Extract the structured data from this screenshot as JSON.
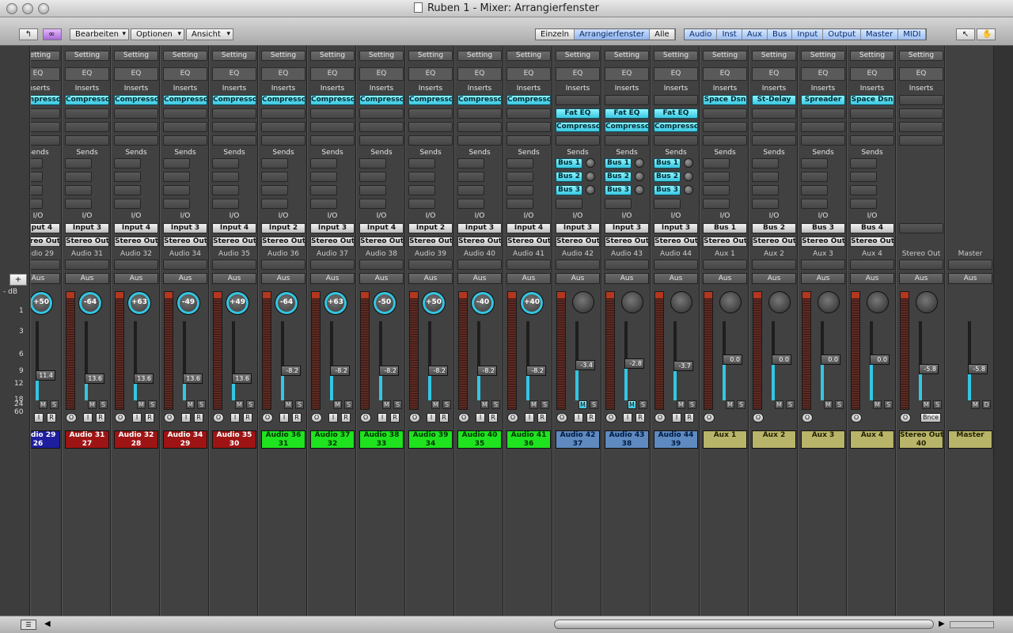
{
  "window": {
    "title": "Ruben 1 - Mixer: Arrangierfenster"
  },
  "toolbar": {
    "edit": "Bearbeiten",
    "options": "Optionen",
    "view": "Ansicht",
    "views": [
      {
        "label": "Einzeln",
        "on": false
      },
      {
        "label": "Arrangierfenster",
        "on": true
      },
      {
        "label": "Alle",
        "on": false
      }
    ],
    "filters": [
      "Audio",
      "Inst",
      "Aux",
      "Bus",
      "Input",
      "Output",
      "Master",
      "MIDI"
    ]
  },
  "labels": {
    "setting": "Setting",
    "eq": "EQ",
    "inserts": "Inserts",
    "sends": "Sends",
    "io": "I/O",
    "aus": "Aus",
    "plus": "+",
    "db": "- dB",
    "scale": [
      "1",
      "3",
      "6",
      "9",
      "12",
      "18",
      "24",
      "60"
    ]
  },
  "strips": [
    {
      "name": "Audio 29",
      "input": "Input 4",
      "output": "Stereo Out",
      "inserts": [
        "Compresso"
      ],
      "sends": [],
      "pan": "+50",
      "vol": "11.4",
      "level": 0.32,
      "color": "#1e1e9e",
      "tc": "#ffffff",
      "cname": [
        "Audio 29",
        "26"
      ],
      "w": 40
    },
    {
      "name": "Audio 31",
      "input": "Input 3",
      "output": "Stereo Out",
      "inserts": [
        "Compresso"
      ],
      "sends": [],
      "pan": "-64",
      "vol": "13.6",
      "level": 0.28,
      "color": "#9e1414",
      "tc": "#ffffff",
      "cname": [
        "Audio 31",
        "27"
      ]
    },
    {
      "name": "Audio 32",
      "input": "Input 4",
      "output": "Stereo Out",
      "inserts": [
        "Compresso"
      ],
      "sends": [],
      "pan": "+63",
      "vol": "13.6",
      "level": 0.28,
      "color": "#9e1414",
      "tc": "#ffffff",
      "cname": [
        "Audio 32",
        "28"
      ]
    },
    {
      "name": "Audio 34",
      "input": "Input 3",
      "output": "Stereo Out",
      "inserts": [
        "Compresso"
      ],
      "sends": [],
      "pan": "-49",
      "vol": "13.6",
      "level": 0.28,
      "color": "#9e1414",
      "tc": "#ffffff",
      "cname": [
        "Audio 34",
        "29"
      ]
    },
    {
      "name": "Audio 35",
      "input": "Input 4",
      "output": "Stereo Out",
      "inserts": [
        "Compresso"
      ],
      "sends": [],
      "pan": "+49",
      "vol": "13.6",
      "level": 0.28,
      "color": "#9e1414",
      "tc": "#ffffff",
      "cname": [
        "Audio 35",
        "30"
      ]
    },
    {
      "name": "Audio 36",
      "input": "Input 2",
      "output": "Stereo Out",
      "inserts": [
        "Compresso"
      ],
      "sends": [],
      "pan": "-64",
      "vol": "-8.2",
      "level": 0.38,
      "color": "#1fe31f",
      "tc": "#003300",
      "cname": [
        "Audio 36",
        "31"
      ]
    },
    {
      "name": "Audio 37",
      "input": "Input 3",
      "output": "Stereo Out",
      "inserts": [
        "Compresso"
      ],
      "sends": [],
      "pan": "+63",
      "vol": "-8.2",
      "level": 0.38,
      "color": "#1fe31f",
      "tc": "#003300",
      "cname": [
        "Audio 37",
        "32"
      ]
    },
    {
      "name": "Audio 38",
      "input": "Input 4",
      "output": "Stereo Out",
      "inserts": [
        "Compresso"
      ],
      "sends": [],
      "pan": "-50",
      "vol": "-8.2",
      "level": 0.38,
      "color": "#1fe31f",
      "tc": "#003300",
      "cname": [
        "Audio 38",
        "33"
      ]
    },
    {
      "name": "Audio 39",
      "input": "Input 2",
      "output": "Stereo Out",
      "inserts": [
        "Compresso"
      ],
      "sends": [],
      "pan": "+50",
      "vol": "-8.2",
      "level": 0.38,
      "color": "#1fe31f",
      "tc": "#003300",
      "cname": [
        "Audio 39",
        "34"
      ]
    },
    {
      "name": "Audio 40",
      "input": "Input 3",
      "output": "Stereo Out",
      "inserts": [
        "Compresso"
      ],
      "sends": [],
      "pan": "-40",
      "vol": "-8.2",
      "level": 0.38,
      "color": "#1fe31f",
      "tc": "#003300",
      "cname": [
        "Audio 40",
        "35"
      ]
    },
    {
      "name": "Audio 41",
      "input": "Input 4",
      "output": "Stereo Out",
      "inserts": [
        "Compresso"
      ],
      "sends": [],
      "pan": "+40",
      "vol": "-8.2",
      "level": 0.38,
      "color": "#1fe31f",
      "tc": "#003300",
      "cname": [
        "Audio 41",
        "36"
      ]
    },
    {
      "name": "Audio 42",
      "input": "Input 3",
      "output": "Stereo Out",
      "inserts": [
        "",
        "Fat EQ",
        "Compresso"
      ],
      "sends": [
        "Bus 1",
        "Bus 2",
        "Bus 3"
      ],
      "pan": "",
      "vol": "-3.4",
      "level": 0.45,
      "mute": true,
      "color": "#5e8ac0",
      "tc": "#001a40",
      "cname": [
        "Audio 42",
        "37"
      ]
    },
    {
      "name": "Audio 43",
      "input": "Input 3",
      "output": "Stereo Out",
      "inserts": [
        "",
        "Fat EQ",
        "Compresso"
      ],
      "sends": [
        "Bus 1",
        "Bus 2",
        "Bus 3"
      ],
      "pan": "",
      "vol": "-2.8",
      "level": 0.47,
      "mute": true,
      "color": "#5e8ac0",
      "tc": "#001a40",
      "cname": [
        "Audio 43",
        "38"
      ]
    },
    {
      "name": "Audio 44",
      "input": "Input 3",
      "output": "Stereo Out",
      "inserts": [
        "",
        "Fat EQ",
        "Compresso"
      ],
      "sends": [
        "Bus 1",
        "Bus 2",
        "Bus 3"
      ],
      "pan": "",
      "vol": "-3.7",
      "level": 0.44,
      "color": "#5e8ac0",
      "tc": "#001a40",
      "cname": [
        "Audio 44",
        "39"
      ]
    },
    {
      "name": "Aux 1",
      "input": "Bus 1",
      "output": "Stereo Out",
      "inserts": [
        "Space Dsn"
      ],
      "sends": [],
      "pan": "",
      "vol": "0.0",
      "level": 0.52,
      "color": "#b8b46a",
      "tc": "#222200",
      "cname": [
        "Aux 1",
        ""
      ],
      "aux": true
    },
    {
      "name": "Aux 2",
      "input": "Bus 2",
      "output": "Stereo Out",
      "inserts": [
        "St-Delay"
      ],
      "sends": [],
      "pan": "",
      "vol": "0.0",
      "level": 0.52,
      "color": "#b8b46a",
      "tc": "#222200",
      "cname": [
        "Aux 2",
        ""
      ],
      "aux": true
    },
    {
      "name": "Aux 3",
      "input": "Bus 3",
      "output": "Stereo Out",
      "inserts": [
        "Spreader"
      ],
      "sends": [],
      "pan": "",
      "vol": "0.0",
      "level": 0.52,
      "color": "#b8b46a",
      "tc": "#222200",
      "cname": [
        "Aux 3",
        ""
      ],
      "aux": true
    },
    {
      "name": "Aux 4",
      "input": "Bus 4",
      "output": "Stereo Out",
      "inserts": [
        "Space Dsn"
      ],
      "sends": [],
      "pan": "",
      "vol": "0.0",
      "level": 0.52,
      "color": "#b8b46a",
      "tc": "#222200",
      "cname": [
        "Aux 4",
        ""
      ],
      "aux": true
    },
    {
      "name": "Stereo Out",
      "input": "",
      "output": "",
      "inserts": [],
      "sends": [],
      "pan": "",
      "vol": "-5.8",
      "level": 0.4,
      "color": "#b8b46a",
      "tc": "#222200",
      "cname": [
        "Stereo Out",
        "40"
      ],
      "out": true
    },
    {
      "name": "Master",
      "input": "",
      "output": "",
      "inserts": [],
      "sends": [],
      "pan": "",
      "vol": "-5.8",
      "level": 0.4,
      "color": "#b8b46a",
      "tc": "#222200",
      "cname": [
        "Master",
        ""
      ],
      "master": true
    }
  ],
  "buttons": {
    "m": "M",
    "s": "S",
    "i": "I",
    "r": "R",
    "o": "O",
    "d": "D",
    "bnce": "Bnce"
  }
}
